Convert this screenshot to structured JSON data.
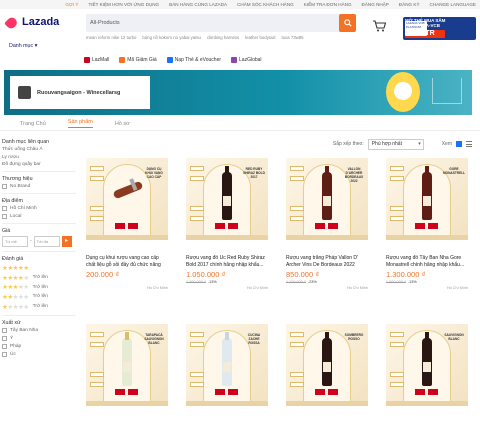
{
  "topbar": [
    "GỢI Ý",
    "TIẾT KIỆM HƠN VỚI ỨNG DỤNG",
    "BÁN HÀNG CÙNG LAZADA",
    "CHĂM SÓC KHÁCH HÀNG",
    "KIỂM TRA ĐƠN HÀNG",
    "ĐĂNG NHẬP",
    "ĐĂNG KÝ",
    "CHANGE LANGUAGE"
  ],
  "header": {
    "logo": "Lazada",
    "category": "Danh mục",
    "search_value": "All-Products",
    "suggestions": [
      "mean reform nike 12 turbo",
      "búng nồ kokoro no yabai yatsu",
      "climbing harness",
      "leather bodysuit",
      "tuxa 73w85"
    ],
    "promo_line1": "MỞ THẺ MUA SẮM",
    "promo_line2": "LAZADA-VCB",
    "promo_amount": "4.2TR",
    "promo_card": "LAZADA VCB PLATINUM"
  },
  "services": [
    "LazMall",
    "Mã Giảm Giá",
    "Nạp Thẻ & eVoucher",
    "LazGlobal"
  ],
  "store": {
    "name": "Ruouvangsaigon - Winecellarsg"
  },
  "tabs": [
    "Trang Chủ",
    "Sản phẩm",
    "Hồ sơ"
  ],
  "sidebar": {
    "related_title": "Danh mục liên quan",
    "related": [
      "Thức uống Châu Á",
      "Ly rượu",
      "Đồ đựng quầy bar"
    ],
    "brand_title": "Thương hiệu",
    "brand": [
      "No Brand"
    ],
    "location_title": "Địa điểm",
    "locations": [
      "Hồ Chí Minh",
      "Local"
    ],
    "price_title": "Giá",
    "price_from": "Từ mê",
    "price_to": "Tới đa",
    "rating_title": "Đánh giá",
    "rating_suffix": "Trở lên",
    "origin_title": "Xuất xứ",
    "origins": [
      "Tây Ban Nha",
      "Ý",
      "Pháp",
      "Úc"
    ]
  },
  "sort": {
    "label": "Sắp xếp theo:",
    "value": "Phù hợp nhất",
    "view_label": "Xem"
  },
  "products": [
    {
      "title": "Dụng cụ khui rượu vang cao cấp chất liệu gỗ sồi đầy đủ chức năng chính...",
      "price": "200.000 ₫",
      "original": "",
      "discount": "",
      "location": "Hồ Chí Minh",
      "label": "DỤNG CỤ KHUI VANG CAO CẤP"
    },
    {
      "title": "Rượu vang đỏ Úc Red Ruby Shiraz Bold 2017 chính hãng nhập khẩu...",
      "price": "1.050.000 ₫",
      "original": "1.200.000 ₫",
      "discount": "-13%",
      "location": "Hồ Chí Minh",
      "label": "RED RUBY SHIRAZ BOLD 2017"
    },
    {
      "title": "Rượu vang trắng Pháp Vallon D' Archer Vins De Bordeaux 2022 chính...",
      "price": "850.000 ₫",
      "original": "1.100.000 ₫",
      "discount": "-23%",
      "location": "Hồ Chí Minh",
      "label": "VALLON D'ARCHER BORDEAUX 2022"
    },
    {
      "title": "Rượu vang đỏ Tây Ban Nha Gore Monastrell chính hãng nhập khẩu...",
      "price": "1.300.000 ₫",
      "original": "1.500.000 ₫",
      "discount": "-13%",
      "location": "Hồ Chí Minh",
      "label": "GORE MONASTRELL"
    },
    {
      "title": "",
      "price": "",
      "original": "",
      "discount": "",
      "location": "",
      "label": "TARAPACÁ SAUVIGNON BLANC"
    },
    {
      "title": "",
      "price": "",
      "original": "",
      "discount": "",
      "location": "",
      "label": "CUCINA ZACHE ROSSA"
    },
    {
      "title": "",
      "price": "",
      "original": "",
      "discount": "",
      "location": "",
      "label": "SOMBRERO ROSSO"
    },
    {
      "title": "",
      "price": "",
      "original": "",
      "discount": "",
      "location": "",
      "label": "SAUVIGNON BLANC"
    }
  ]
}
